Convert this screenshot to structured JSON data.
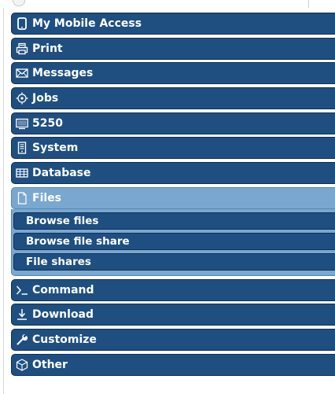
{
  "menu": {
    "items": [
      {
        "label": "My Mobile Access",
        "icon": "mobile-icon"
      },
      {
        "label": "Print",
        "icon": "printer-icon"
      },
      {
        "label": "Messages",
        "icon": "envelope-icon"
      },
      {
        "label": "Jobs",
        "icon": "target-icon"
      },
      {
        "label": "5250",
        "icon": "terminal-screen-icon"
      },
      {
        "label": "System",
        "icon": "server-icon"
      },
      {
        "label": "Database",
        "icon": "table-icon"
      },
      {
        "label": "Files",
        "icon": "file-icon",
        "active": true
      },
      {
        "label": "Command",
        "icon": "prompt-icon"
      },
      {
        "label": "Download",
        "icon": "download-icon"
      },
      {
        "label": "Customize",
        "icon": "wrench-icon"
      },
      {
        "label": "Other",
        "icon": "cube-icon"
      }
    ],
    "files_submenu": [
      {
        "label": "Browse files"
      },
      {
        "label": "Browse file share"
      },
      {
        "label": "File shares"
      }
    ]
  },
  "colors": {
    "item_bg": "#1f4f80",
    "active_bg": "#7aa7cf"
  }
}
